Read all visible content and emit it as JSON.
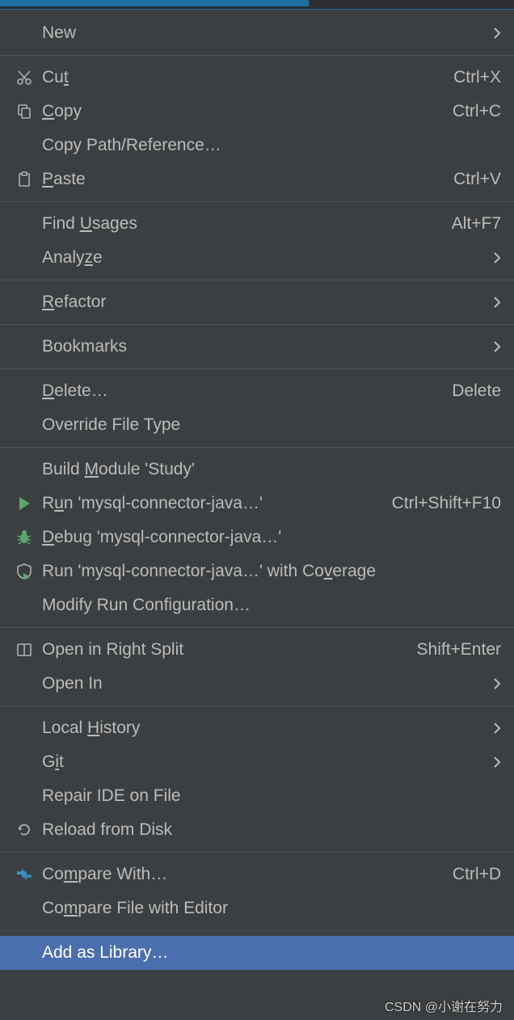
{
  "menu": {
    "new": {
      "label": "New"
    },
    "cut": {
      "pre": "Cu",
      "mn": "t",
      "post": "",
      "shortcut": "Ctrl+X"
    },
    "copy": {
      "pre": "",
      "mn": "C",
      "post": "opy",
      "shortcut": "Ctrl+C"
    },
    "copypath": {
      "label": "Copy Path/Reference…"
    },
    "paste": {
      "pre": "",
      "mn": "P",
      "post": "aste",
      "shortcut": "Ctrl+V"
    },
    "findusages": {
      "pre": "Find ",
      "mn": "U",
      "post": "sages",
      "shortcut": "Alt+F7"
    },
    "analyze": {
      "pre": "Analy",
      "mn": "z",
      "post": "e"
    },
    "refactor": {
      "pre": "",
      "mn": "R",
      "post": "efactor"
    },
    "bookmarks": {
      "label": "Bookmarks"
    },
    "delete": {
      "pre": "",
      "mn": "D",
      "post": "elete…",
      "shortcut": "Delete"
    },
    "override": {
      "label": "Override File Type"
    },
    "buildmodule": {
      "pre": "Build ",
      "mn": "M",
      "post": "odule 'Study'"
    },
    "run": {
      "pre": "R",
      "mn": "u",
      "post": "n 'mysql-connector-java…'",
      "shortcut": "Ctrl+Shift+F10"
    },
    "debug": {
      "pre": "",
      "mn": "D",
      "post": "ebug 'mysql-connector-java…'"
    },
    "coverage": {
      "pre": "Run 'mysql-connector-java…' with Co",
      "mn": "v",
      "post": "erage"
    },
    "modifyrun": {
      "label": "Modify Run Configuration…"
    },
    "openrsplit": {
      "label": "Open in Right Split",
      "shortcut": "Shift+Enter"
    },
    "openin": {
      "label": "Open In"
    },
    "localhist": {
      "pre": "Local ",
      "mn": "H",
      "post": "istory"
    },
    "git": {
      "pre": "G",
      "mn": "i",
      "post": "t"
    },
    "repair": {
      "label": "Repair IDE on File"
    },
    "reload": {
      "label": "Reload from Disk"
    },
    "comparewith": {
      "pre": "Co",
      "mn": "m",
      "post": "pare With…",
      "shortcut": "Ctrl+D"
    },
    "comparefile": {
      "pre": "Co",
      "mn": "m",
      "post": "pare File with Editor"
    },
    "addlib": {
      "label": "Add as Library…"
    }
  },
  "watermark": "CSDN @小谢在努力"
}
